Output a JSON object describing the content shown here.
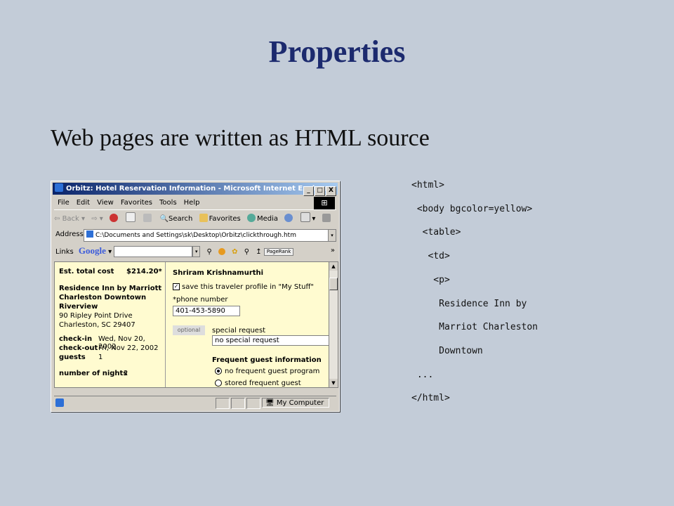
{
  "slide": {
    "title": "Properties",
    "bullet": "Web pages are written as HTML source"
  },
  "browser": {
    "title": "Orbitz: Hotel Reservation Information - Microsoft Internet Explorer",
    "window_buttons": [
      "_",
      "□",
      "X"
    ],
    "menu": [
      "File",
      "Edit",
      "View",
      "Favorites",
      "Tools",
      "Help"
    ],
    "toolbar": {
      "back": "Back",
      "search": "Search",
      "favorites": "Favorites",
      "media": "Media"
    },
    "address": {
      "label": "Address",
      "value": "C:\\Documents and Settings\\sk\\Desktop\\Orbitz\\clickthrough.htm"
    },
    "links_bar": {
      "links_label": "Links",
      "google": "Google",
      "pagerank": "PageRank"
    },
    "page": {
      "left": {
        "est_cost_label": "Est. total cost",
        "est_cost_value": "$214.20*",
        "hotel_name": [
          "Residence Inn by Marriott",
          "Charleston Downtown",
          "Riverview"
        ],
        "address_lines": [
          "90 Ripley Point Drive",
          "Charleston, SC 29407"
        ],
        "checkin_label": "check-in",
        "checkin_value": "Wed, Nov 20, 2002",
        "checkout_label": "check-out",
        "checkout_value": "Fri, Nov 22, 2002",
        "guests_label": "guests",
        "guests_value": "1",
        "nights_label": "number of nights",
        "nights_value": "2"
      },
      "right": {
        "traveler_name": "Shriram Krishnamurthi",
        "save_profile": "save this traveler profile in \"My Stuff\"",
        "phone_label": "*phone number",
        "phone_value": "401-453-5890",
        "optional_tag": "optional",
        "special_request_label": "special request",
        "special_request_value": "no special request",
        "fgi_label": "Frequent guest information",
        "fgi_option1": "no frequent guest program",
        "fgi_option2": "stored frequent guest program"
      }
    },
    "status": {
      "zone": "My Computer"
    }
  },
  "code_lines": [
    "<html>",
    " <body bgcolor=yellow>",
    "  <table>",
    "   <td>",
    "    <p>",
    "     Residence Inn by",
    "     Marriot Charleston",
    "     Downtown",
    " ...",
    "</html>"
  ],
  "colors": {
    "background": "#c3ccd8",
    "title": "#1c2a6e",
    "page_bg": "#fffbd0",
    "titlebar": "#0a246a"
  }
}
